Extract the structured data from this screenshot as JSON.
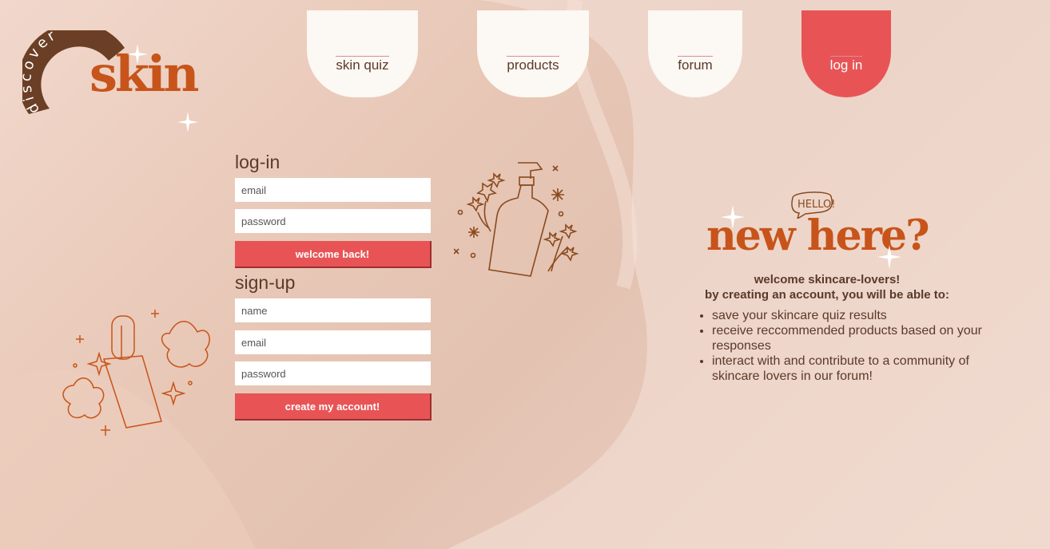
{
  "logo": {
    "top_word": "discover",
    "main_word": "skin"
  },
  "nav": {
    "items": [
      {
        "label": "skin quiz"
      },
      {
        "label": "products"
      },
      {
        "label": "forum"
      },
      {
        "label": "log in"
      }
    ],
    "active": "log in"
  },
  "login": {
    "heading": "log-in",
    "email_placeholder": "email",
    "password_placeholder": "password",
    "submit_label": "welcome back!"
  },
  "signup": {
    "heading": "sign-up",
    "name_placeholder": "name",
    "email_placeholder": "email",
    "password_placeholder": "password",
    "submit_label": "create my account!"
  },
  "info": {
    "hello_badge": "HELLO!",
    "headline": "new here?",
    "welcome_line": "welcome skincare-lovers!",
    "subline": "by creating an account, you will be able to:",
    "benefits": [
      "save your skincare quiz results",
      "receive reccommended products based on your responses",
      "interact with and contribute to a community of skincare lovers in our forum!"
    ]
  },
  "colors": {
    "accent": "#e85455",
    "brand_orange": "#c7541a",
    "text_brown": "#5a3a2a",
    "tab_bg": "#fcf8f3"
  },
  "icons": [
    "sparkle-icon",
    "pump-bottle-icon",
    "serum-bottle-icon",
    "flower-icon"
  ]
}
